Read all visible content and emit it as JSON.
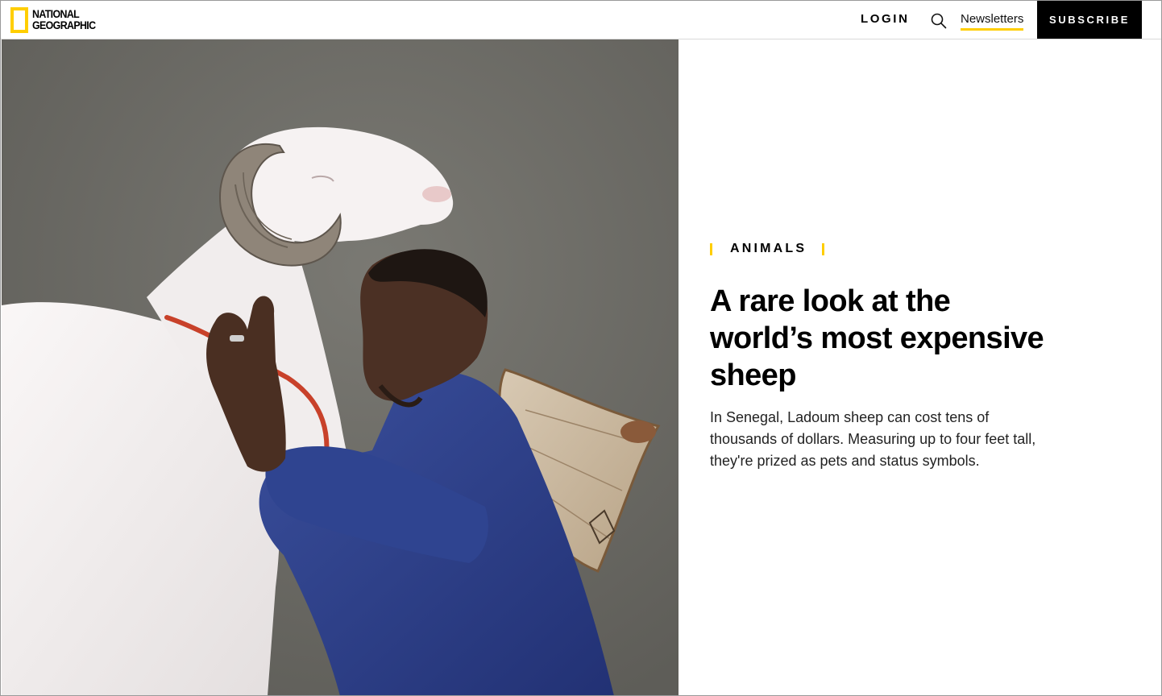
{
  "header": {
    "logo_line1": "NATIONAL",
    "logo_line2": "GEOGRAPHIC",
    "login_label": "LOGIN",
    "search_icon": "search-icon",
    "newsletters_label": "Newsletters",
    "subscribe_label": "SUBSCRIBE"
  },
  "hero": {
    "image_subject": "man-with-white-ram-photo",
    "category": "ANIMALS",
    "headline": "A rare look at the world’s most expensive sheep",
    "dek": "In Senegal, Ladoum sheep can cost tens of thousands of dollars. Measuring up to four feet tall, they're prized as pets and status symbols."
  },
  "colors": {
    "accent_yellow": "#ffce00",
    "subscribe_bg": "#000000",
    "photo_background": "#6d6c67",
    "shirt_blue": "#2c3f86",
    "ram_white": "#f3efef"
  }
}
